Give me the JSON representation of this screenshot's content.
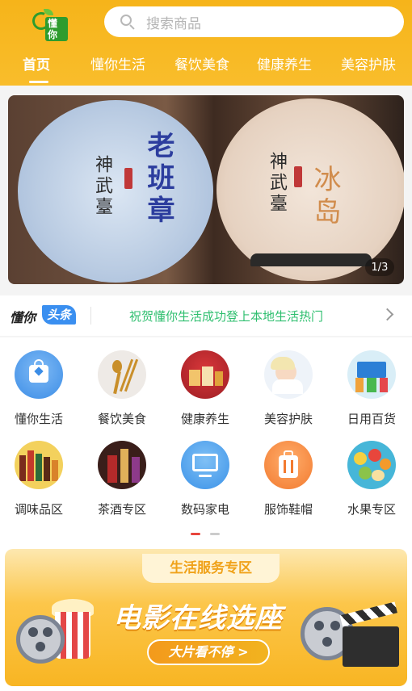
{
  "header": {
    "logo_text": "懂你",
    "search_placeholder": "搜索商品",
    "tabs": [
      {
        "label": "首页",
        "active": true
      },
      {
        "label": "懂你生活",
        "active": false
      },
      {
        "label": "餐饮美食",
        "active": false
      },
      {
        "label": "健康养生",
        "active": false
      },
      {
        "label": "美容护肤",
        "active": false
      }
    ],
    "colors": {
      "bar": "#f6b41a",
      "text": "#ffffff"
    }
  },
  "banner": {
    "slides": [
      {
        "brand": "神武臺",
        "title": "老班章",
        "title_color": "#2c3d9e"
      },
      {
        "brand": "神武臺",
        "title": "冰岛",
        "title_color": "#d18c4c"
      }
    ],
    "pager": "1/3"
  },
  "news": {
    "brand_part1": "懂你",
    "brand_part2": "头条",
    "headline": "祝贺懂你生活成功登上本地生活热门",
    "headline_color": "#2fbf6f"
  },
  "categories": [
    {
      "label": "懂你生活",
      "icon": "shopping-bag-icon"
    },
    {
      "label": "餐饮美食",
      "icon": "spoon-chopsticks-icon"
    },
    {
      "label": "健康养生",
      "icon": "health-products-icon"
    },
    {
      "label": "美容护肤",
      "icon": "skincare-icon"
    },
    {
      "label": "日用百货",
      "icon": "daily-goods-icon"
    },
    {
      "label": "调味品区",
      "icon": "seasoning-icon"
    },
    {
      "label": "茶酒专区",
      "icon": "tea-wine-icon"
    },
    {
      "label": "数码家电",
      "icon": "monitor-icon"
    },
    {
      "label": "服饰鞋帽",
      "icon": "luggage-icon"
    },
    {
      "label": "水果专区",
      "icon": "fruit-icon"
    }
  ],
  "category_pager": {
    "active_color": "#e8453c",
    "inactive_color": "#cccccc"
  },
  "promo": {
    "section_title": "生活服务专区",
    "headline": "电影在线选座",
    "button_label": "大片看不停 >"
  }
}
